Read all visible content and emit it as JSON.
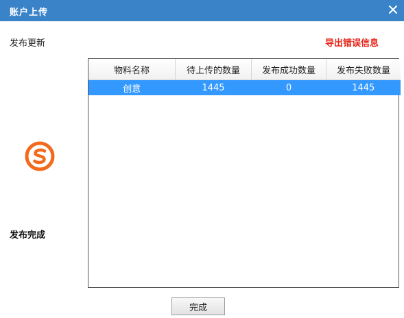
{
  "window": {
    "title": "账户上传",
    "close_glyph": "✕"
  },
  "section_label": "发布更新",
  "export_link": "导出错误信息",
  "status_label": "发布完成",
  "logo_icon": "sogou-logo-icon",
  "accent_color": "#3a83c8",
  "table": {
    "columns": [
      "物料名称",
      "待上传的数量",
      "发布成功数量",
      "发布失败数量"
    ],
    "rows": [
      [
        "创意",
        "1445",
        "0",
        "1445"
      ]
    ],
    "selected_row_color": "#3399ff"
  },
  "finish_button": "完成"
}
